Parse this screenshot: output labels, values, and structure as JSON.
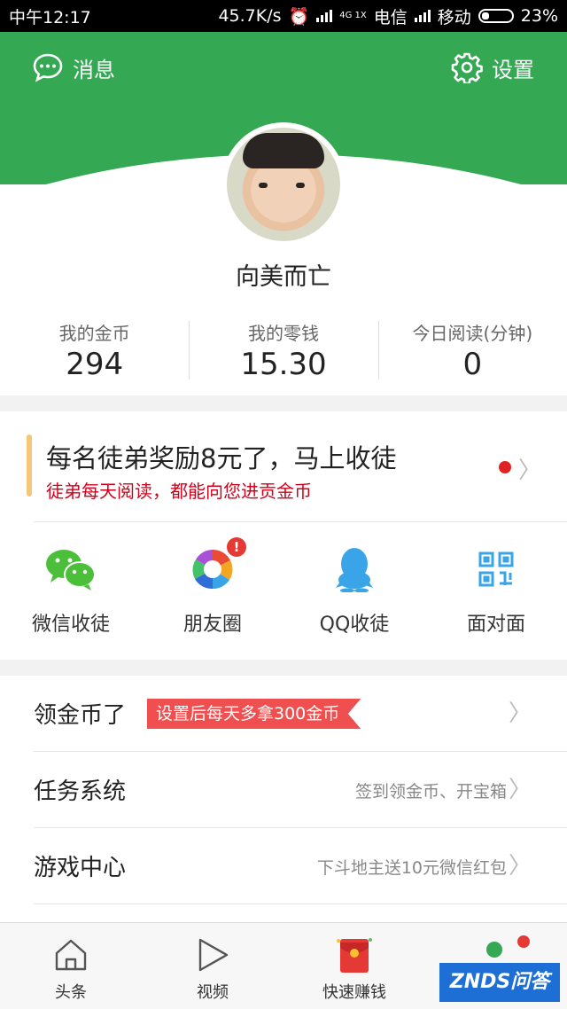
{
  "status_bar": {
    "time": "中午12:17",
    "speed": "45.7K/s",
    "network_type": "4G 1X",
    "carrier1": "电信",
    "carrier2": "移动",
    "battery": "23%"
  },
  "header": {
    "messages_label": "消息",
    "settings_label": "设置",
    "accent_color": "#34a853"
  },
  "profile": {
    "username": "向美而亡"
  },
  "stats": [
    {
      "label": "我的金币",
      "value": "294"
    },
    {
      "label": "我的零钱",
      "value": "15.30"
    },
    {
      "label": "今日阅读(分钟)",
      "value": "0"
    }
  ],
  "invite": {
    "title": "每名徒弟奖励8元了，马上收徒",
    "subtitle": "徒弟每天阅读，都能向您进贡金币",
    "share_options": [
      {
        "label": "微信收徒",
        "icon": "wechat-icon"
      },
      {
        "label": "朋友圈",
        "icon": "moments-icon",
        "badge": "!"
      },
      {
        "label": "QQ收徒",
        "icon": "qq-icon"
      },
      {
        "label": "面对面",
        "icon": "qrcode-icon"
      }
    ]
  },
  "menu": [
    {
      "title": "领金币了",
      "tag": "设置后每天多拿300金币",
      "hint": ""
    },
    {
      "title": "任务系统",
      "tag": "",
      "hint": "签到领金币、开宝箱"
    },
    {
      "title": "游戏中心",
      "tag": "",
      "hint": "下斗地主送10元微信红包"
    }
  ],
  "tabs": [
    {
      "label": "头条",
      "icon": "home-icon"
    },
    {
      "label": "视频",
      "icon": "play-icon"
    },
    {
      "label": "快速赚钱",
      "icon": "red-envelope-icon"
    },
    {
      "label": "",
      "icon": "profile-icon"
    }
  ],
  "watermark": "ZNDS问答"
}
